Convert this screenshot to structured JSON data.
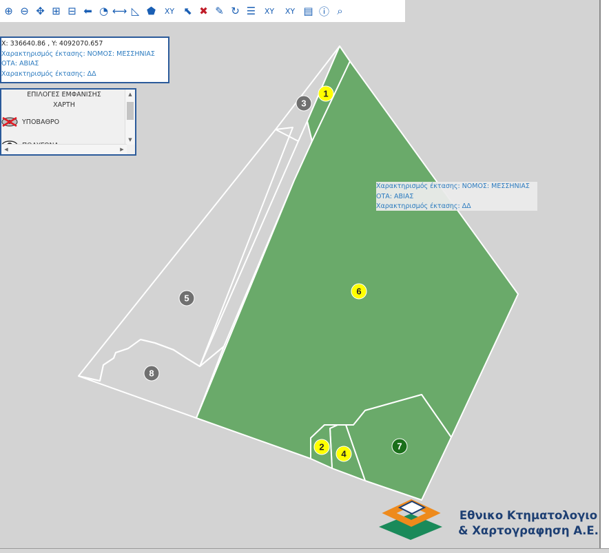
{
  "toolbar": {
    "tools": [
      {
        "name": "zoom-in-icon",
        "glyph": "⊕"
      },
      {
        "name": "zoom-out-icon",
        "glyph": "⊖"
      },
      {
        "name": "pan-icon",
        "glyph": "✥"
      },
      {
        "name": "zoom-box-in-icon",
        "glyph": "⊞"
      },
      {
        "name": "zoom-box-out-icon",
        "glyph": "⊟"
      },
      {
        "name": "previous-extent-icon",
        "glyph": "⬅"
      },
      {
        "name": "full-extent-icon",
        "glyph": "◔"
      },
      {
        "name": "measure-distance-icon",
        "glyph": "⟷"
      },
      {
        "name": "measure-angle-icon",
        "glyph": "◺"
      },
      {
        "name": "measure-area-icon",
        "glyph": "⬟"
      },
      {
        "name": "goto-xy-icon",
        "glyph": "XY"
      },
      {
        "name": "select-icon",
        "glyph": "⬉"
      },
      {
        "name": "clear-selection-icon",
        "glyph": "✖"
      },
      {
        "name": "draw-edit-icon",
        "glyph": "✎"
      },
      {
        "name": "refresh-icon",
        "glyph": "↻"
      },
      {
        "name": "legend-icon",
        "glyph": "☰"
      },
      {
        "name": "coordinates-table-icon",
        "glyph": "XY"
      },
      {
        "name": "export-coordinates-icon",
        "glyph": "XY"
      },
      {
        "name": "print-map-icon",
        "glyph": "▤"
      },
      {
        "name": "info-icon",
        "glyph": "ⓘ"
      },
      {
        "name": "search-icon",
        "glyph": "⌕"
      }
    ]
  },
  "coord_panel": {
    "coords": "X: 336640.86 , Y: 4092070.657",
    "line1": "Χαρακτηρισμός έκτασης: ΝΟΜΟΣ: ΜΕΣΣΗΝΙΑΣ",
    "line2": "ΟΤΑ: ΑΒΙΑΣ",
    "line3": "Χαρακτηρισμός έκτασης: ΔΔ"
  },
  "layers_panel": {
    "title_line1": "ΕΠΙΛΟΓΕΣ ΕΜΦΑΝΙΣΗΣ",
    "title_line2": "ΧΑΡΤΗ",
    "items": [
      {
        "label": "ΥΠΟΒΑΘΡΟ",
        "icon": "hidden-eye-icon"
      },
      {
        "label": "ΠΟΛΥΓΩΝΑ",
        "icon": "eye-icon"
      }
    ]
  },
  "tooltip": {
    "line1": "Χαρακτηρισμός έκτασης: ΝΟΜΟΣ: ΜΕΣΣΗΝΙΑΣ",
    "line2": "ΟΤΑ: ΑΒΙΑΣ",
    "line3": "Χαρακτηρισμός έκτασης: ΔΔ"
  },
  "parcels": [
    {
      "id": "parcel-1",
      "label": "1",
      "marker": "yellow",
      "fill": "green"
    },
    {
      "id": "parcel-2",
      "label": "2",
      "marker": "yellow",
      "fill": "green"
    },
    {
      "id": "parcel-3",
      "label": "3",
      "marker": "gray",
      "fill": "none"
    },
    {
      "id": "parcel-4",
      "label": "4",
      "marker": "yellow",
      "fill": "green"
    },
    {
      "id": "parcel-5",
      "label": "5",
      "marker": "gray",
      "fill": "none"
    },
    {
      "id": "parcel-6",
      "label": "6",
      "marker": "yellow",
      "fill": "green"
    },
    {
      "id": "parcel-7",
      "label": "7",
      "marker": "darkgreen",
      "fill": "green"
    },
    {
      "id": "parcel-8",
      "label": "8",
      "marker": "gray",
      "fill": "none"
    }
  ],
  "logo": {
    "line1": "Εθνικο Κτηματολογιο",
    "line2": "& Χαρτογραφηση Α.Ε."
  },
  "colors": {
    "map_background": "#d3d3d3",
    "parcel_fill": "#6aaa6a",
    "parcel_outline": "#ffffff",
    "marker_yellow": "#ffff00",
    "marker_gray": "#707070",
    "marker_darkgreen": "#1a6f1a",
    "panel_text": "#2a7abf",
    "panel_border": "#2a5a9a",
    "logo_blue": "#1d3f73",
    "logo_orange": "#ee8a1c",
    "logo_green": "#1a8a5a"
  }
}
